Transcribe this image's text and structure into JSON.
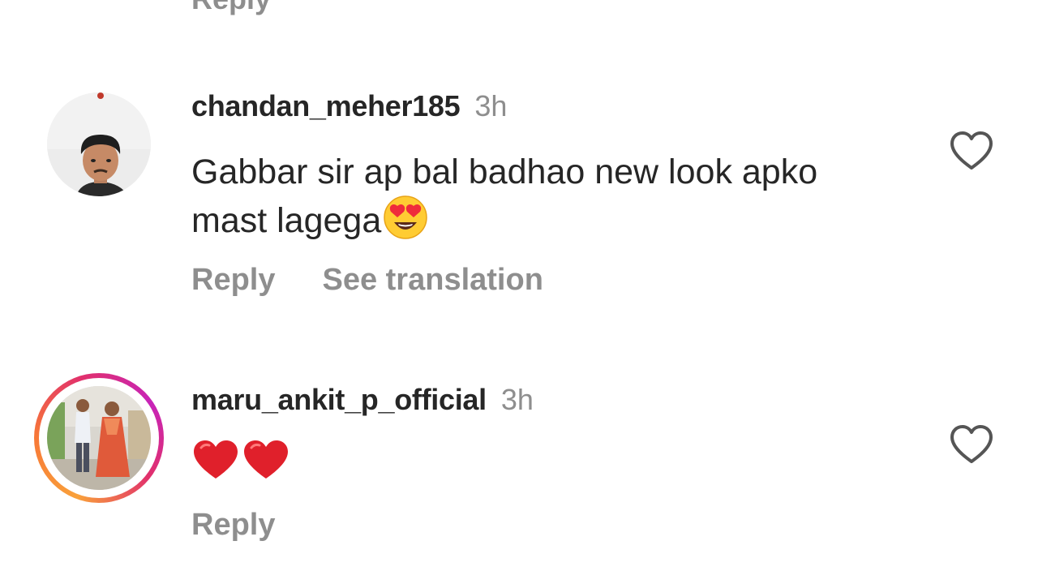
{
  "previous_comment": {
    "reply_label": "Reply"
  },
  "comments": [
    {
      "username": "chandan_meher185",
      "time": "3h",
      "text": "Gabbar sir ap bal badhao new look apko mast lagega",
      "emoji": "heart-eyes-emoji",
      "reply_label": "Reply",
      "translate_label": "See translation",
      "has_story_ring": false
    },
    {
      "username": "maru_ankit_p_official",
      "time": "3h",
      "text": "",
      "emoji": "red-heart-emoji x2",
      "reply_label": "Reply",
      "has_story_ring": true
    }
  ],
  "colors": {
    "primary_text": "#262626",
    "secondary_text": "#8e8e8e",
    "story_ring_start": "#f9a13a",
    "story_ring_end": "#c724b8",
    "heart_red": "#e0202b"
  },
  "icons": {
    "like": "heart-outline-icon"
  }
}
